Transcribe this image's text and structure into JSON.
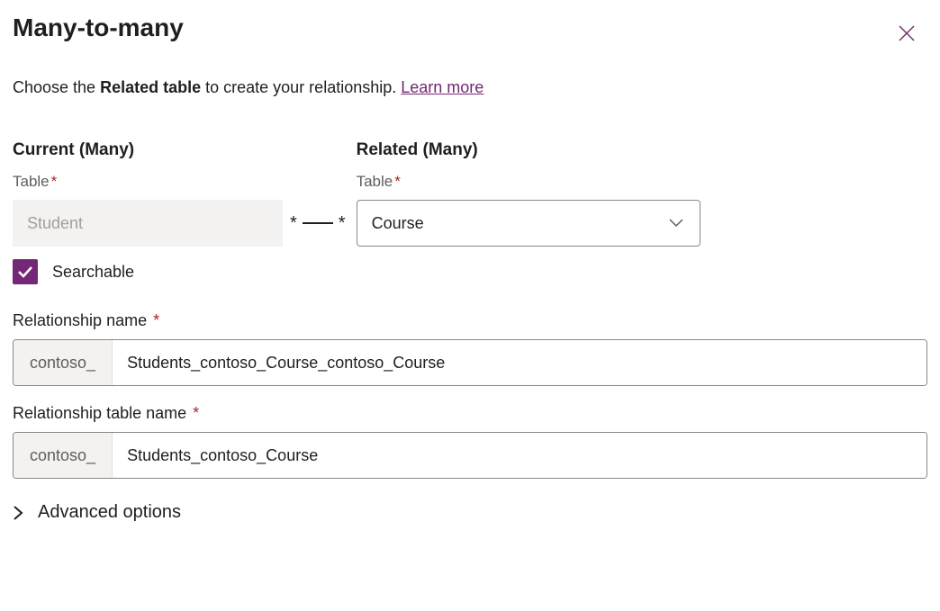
{
  "header": {
    "title": "Many-to-many"
  },
  "description": {
    "prefix": "Choose the ",
    "bold": "Related table",
    "suffix": " to create your relationship. ",
    "learn_more": "Learn more"
  },
  "current": {
    "heading": "Current (Many)",
    "field_label": "Table",
    "value": "Student"
  },
  "related": {
    "heading": "Related (Many)",
    "field_label": "Table",
    "value": "Course"
  },
  "searchable": {
    "label": "Searchable",
    "checked": true
  },
  "relationship_name": {
    "label": "Relationship name",
    "prefix": "contoso_",
    "value": "Students_contoso_Course_contoso_Course"
  },
  "relationship_table_name": {
    "label": "Relationship table name",
    "prefix": "contoso_",
    "value": "Students_contoso_Course"
  },
  "advanced": {
    "label": "Advanced options"
  },
  "connector": {
    "left": "*",
    "right": "*"
  }
}
